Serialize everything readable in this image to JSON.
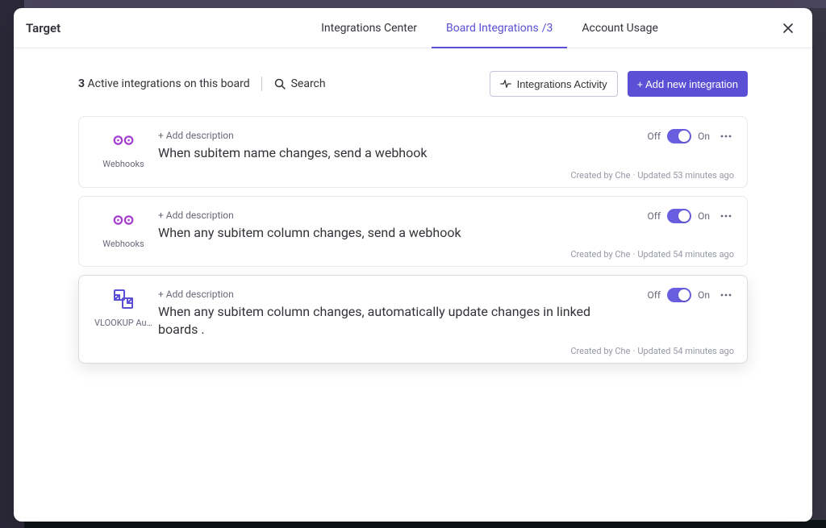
{
  "header": {
    "title": "Target",
    "close_aria": "Close"
  },
  "tabs": {
    "center": "Integrations Center",
    "board_prefix": "Board Integrations",
    "board_sep": " / ",
    "board_count": "3",
    "usage": "Account Usage"
  },
  "toolbar": {
    "active_count": "3",
    "active_suffix": " Active integrations on this board",
    "search_label": "Search",
    "activity_button": "Integrations Activity",
    "add_button": "+ Add new integration"
  },
  "integrations": [
    {
      "app_name": "Webhooks",
      "icon": "webhooks",
      "add_description_label": "+ Add description",
      "title": "When subitem name changes, send a webhook",
      "off_label": "Off",
      "on_label": "On",
      "toggle_on": true,
      "meta_created": "Created by Che",
      "meta_updated": "Updated 53 minutes ago"
    },
    {
      "app_name": "Webhooks",
      "icon": "webhooks",
      "add_description_label": "+ Add description",
      "title": "When any subitem column changes, send a webhook",
      "off_label": "Off",
      "on_label": "On",
      "toggle_on": true,
      "meta_created": "Created by Che",
      "meta_updated": "Updated 54 minutes ago"
    },
    {
      "app_name": "VLOOKUP Auto…",
      "icon": "vlookup",
      "add_description_label": "+ Add description",
      "title": "When any subitem column changes, automatically update changes in linked boards .",
      "off_label": "Off",
      "on_label": "On",
      "toggle_on": true,
      "meta_created": "Created by Che",
      "meta_updated": "Updated 54 minutes ago",
      "highlighted": true
    }
  ]
}
